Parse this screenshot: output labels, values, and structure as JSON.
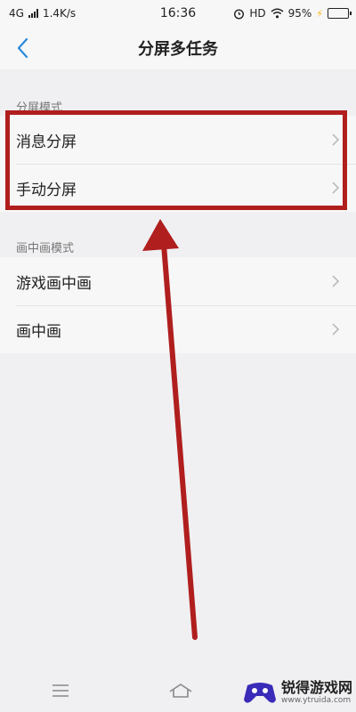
{
  "status_bar": {
    "network": "4G",
    "speed": "1.4K/s",
    "time": "16:36",
    "hd": "HD",
    "battery_percent": "95%",
    "battery_level": 0.95
  },
  "header": {
    "title": "分屏多任务"
  },
  "sections": [
    {
      "label": "分屏模式",
      "items": [
        {
          "label": "消息分屏"
        },
        {
          "label": "手动分屏"
        }
      ]
    },
    {
      "label": "画中画模式",
      "items": [
        {
          "label": "游戏画中画"
        },
        {
          "label": "画中画"
        }
      ]
    }
  ],
  "watermark": {
    "title": "锐得游戏网",
    "url": "www.ytruida.com"
  },
  "colors": {
    "accent": "#2a8ad8",
    "annotation": "#b01e1e",
    "battery": "#2fb844"
  }
}
